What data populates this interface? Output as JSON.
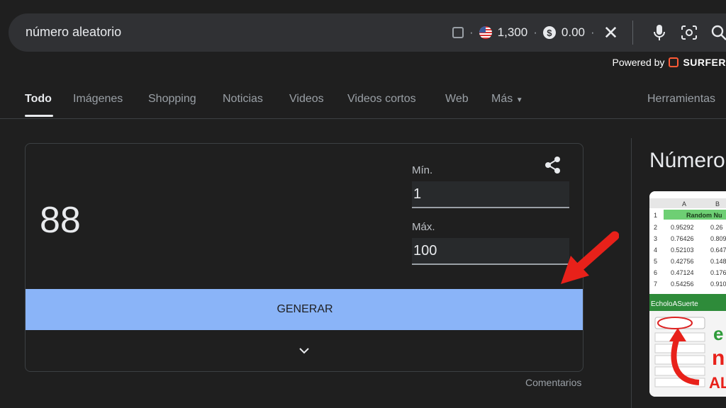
{
  "search": {
    "query": "número aleatorio",
    "credits": "1,300",
    "balance": "0.00"
  },
  "powered": {
    "prefix": "Powered by",
    "brand": "SURFER"
  },
  "tabs": [
    "Todo",
    "Imágenes",
    "Shopping",
    "Noticias",
    "Videos",
    "Videos cortos",
    "Web",
    "Más"
  ],
  "tools_label": "Herramientas",
  "generator": {
    "result": "88",
    "min_label": "Mín.",
    "min_value": "1",
    "max_label": "Máx.",
    "max_value": "100",
    "button_label": "GENERAR"
  },
  "feedback_label": "Comentarios",
  "knowledge_panel": {
    "title": "Número",
    "thumb": {
      "col_a": "A",
      "col_b": "B",
      "header": "Random Nu",
      "rows": [
        [
          "1",
          "",
          ""
        ],
        [
          "2",
          "0.95292",
          "0.26"
        ],
        [
          "3",
          "0.76426",
          "0.809"
        ],
        [
          "4",
          "0.52103",
          "0.647"
        ],
        [
          "5",
          "0.42756",
          "0.148"
        ],
        [
          "6",
          "0.47124",
          "0.176"
        ],
        [
          "7",
          "0.54256",
          "0.910"
        ]
      ],
      "banner": "EcholoASuerte",
      "big1": "e",
      "big2": "n",
      "big3": "AL"
    }
  },
  "colors": {
    "background": "#1f1f1f",
    "accent_button": "#8ab4f8",
    "annotation_arrow": "#e8211a"
  }
}
